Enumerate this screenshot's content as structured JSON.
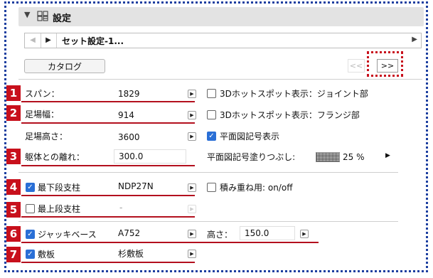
{
  "header": {
    "title": "設定"
  },
  "nav": {
    "set_name": "セット設定-1..."
  },
  "catalog": {
    "label": "カタログ"
  },
  "pager": {
    "prev": "<<",
    "next": ">>"
  },
  "annotations": {
    "n1": "1",
    "n2": "2",
    "n3": "3",
    "n4": "4",
    "n5": "5",
    "n6": "6",
    "n7": "7"
  },
  "rows": {
    "span": {
      "label": "スパン：",
      "value": "1829"
    },
    "width": {
      "label": "足場幅：",
      "value": "914"
    },
    "height": {
      "label": "足場高さ：",
      "value": "3600"
    },
    "offset": {
      "label": "躯体との離れ：",
      "value": "300.0"
    },
    "bottom_support": {
      "label": "最下段支柱",
      "value": "NDP27N",
      "checked": true
    },
    "top_support": {
      "label": "最上段支柱",
      "value": "-",
      "checked": false
    },
    "jack_base": {
      "label": "ジャッキベース",
      "value": "A752",
      "checked": true,
      "height_label": "高さ：",
      "height_value": "150.0"
    },
    "base_plate": {
      "label": "敷板",
      "value": "杉敷板",
      "checked": true
    }
  },
  "right_options": {
    "hotspot_joint": {
      "label": "3Dホットスポット表示：ジョイント部",
      "checked": false
    },
    "hotspot_flange": {
      "label": "3Dホットスポット表示：フランジ部",
      "checked": false
    },
    "plan_symbol": {
      "label": "平面図記号表示",
      "checked": true
    },
    "plan_fill": {
      "label": "平面図記号塗りつぶし:",
      "value": "25 %"
    },
    "stack": {
      "label": "積み重ね用: on/off",
      "checked": false
    }
  },
  "colors": {
    "accent_red": "#c8101c",
    "frame_blue": "#1d3fa0",
    "checkbox_blue": "#2a6fd6"
  }
}
